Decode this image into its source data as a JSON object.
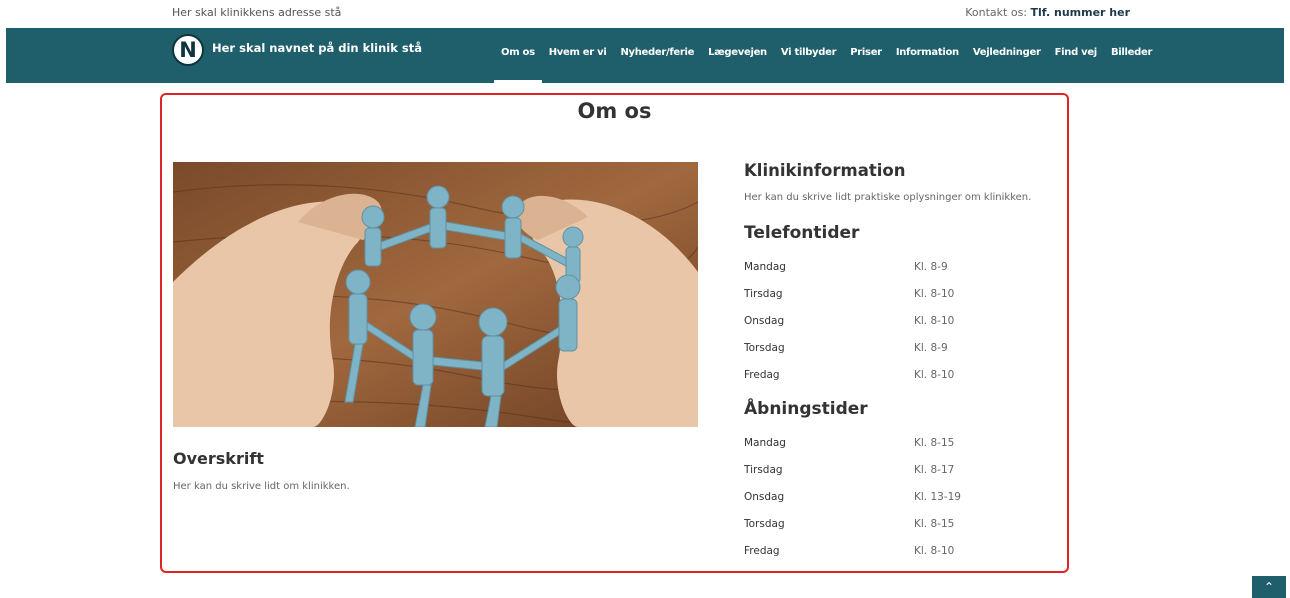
{
  "topbar": {
    "address": "Her skal klinikkens adresse stå",
    "contact_label": "Kontakt os:",
    "contact_value": "Tlf. nummer her"
  },
  "navbar": {
    "logo_letter": "N",
    "clinic_name": "Her skal navnet på din klinik stå",
    "items": [
      {
        "label": "Om os",
        "active": true
      },
      {
        "label": "Hvem er vi"
      },
      {
        "label": "Nyheder/ferie"
      },
      {
        "label": "Lægevejen"
      },
      {
        "label": "Vi tilbyder"
      },
      {
        "label": "Priser"
      },
      {
        "label": "Information"
      },
      {
        "label": "Vejledninger"
      },
      {
        "label": "Find vej"
      },
      {
        "label": "Billeder"
      }
    ]
  },
  "main": {
    "title": "Om os",
    "overskrift": "Overskrift",
    "intro_text": "Her kan du skrive lidt om klinikken.",
    "clinic_info": {
      "heading": "Klinikinformation",
      "text": "Her kan du skrive lidt praktiske oplysninger om klinikken."
    },
    "phone_hours": {
      "heading": "Telefontider",
      "rows": [
        {
          "day": "Mandag",
          "time": "Kl. 8-9"
        },
        {
          "day": "Tirsdag",
          "time": "Kl. 8-10"
        },
        {
          "day": "Onsdag",
          "time": "Kl. 8-10"
        },
        {
          "day": "Torsdag",
          "time": "Kl. 8-9"
        },
        {
          "day": "Fredag",
          "time": "Kl. 8-10"
        }
      ]
    },
    "opening_hours": {
      "heading": "Åbningstider",
      "rows": [
        {
          "day": "Mandag",
          "time": "Kl. 8-15"
        },
        {
          "day": "Tirsdag",
          "time": "Kl. 8-17"
        },
        {
          "day": "Onsdag",
          "time": "Kl. 13-19"
        },
        {
          "day": "Torsdag",
          "time": "Kl. 8-15"
        },
        {
          "day": "Fredag",
          "time": "Kl. 8-10"
        }
      ]
    }
  },
  "scroll_top_icon": "chevron-up-icon",
  "colors": {
    "nav_bg": "#1f5f6b",
    "highlight_border": "#e02424"
  }
}
